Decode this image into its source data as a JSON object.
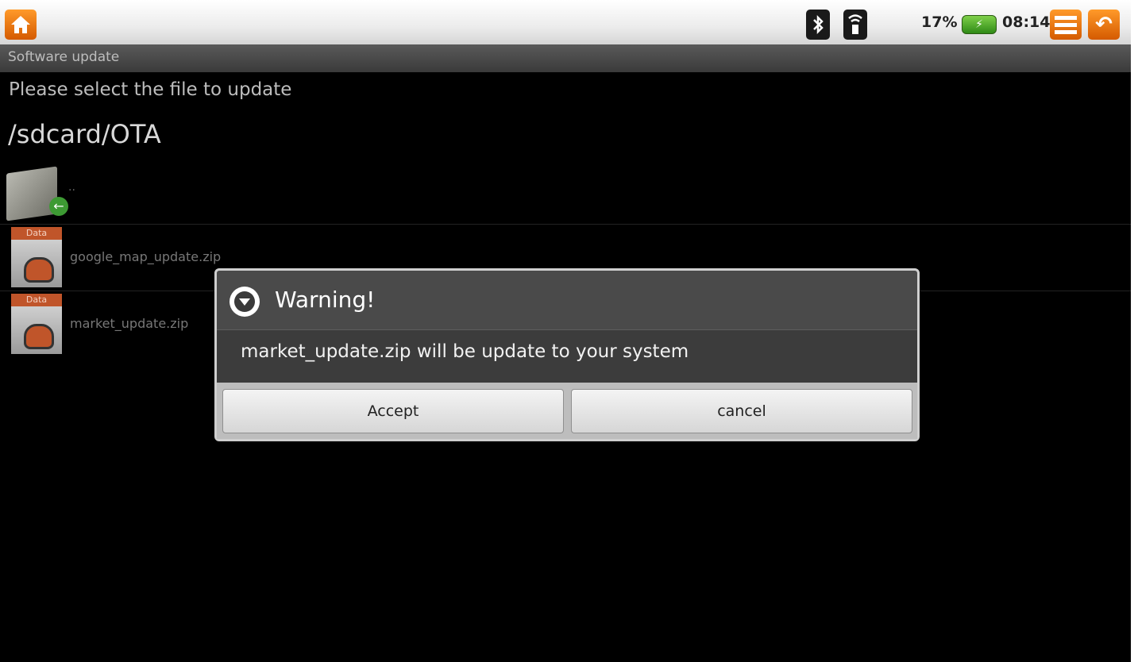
{
  "status_bar": {
    "battery_percent": "17%",
    "time": "08:14",
    "icons": [
      "home-icon",
      "bluetooth-icon",
      "wifi-icon",
      "battery-icon",
      "menu-icon",
      "back-icon"
    ]
  },
  "app": {
    "title": "Software update",
    "prompt": "Please select the file to update",
    "path": "/sdcard/OTA"
  },
  "files": {
    "parent": "..",
    "items": [
      {
        "tag": "Data",
        "name": "google_map_update.zip"
      },
      {
        "tag": "Data",
        "name": "market_update.zip"
      }
    ]
  },
  "dialog": {
    "title": "Warning!",
    "message": "market_update.zip will be update to your system",
    "accept_label": "Accept",
    "cancel_label": "cancel"
  }
}
